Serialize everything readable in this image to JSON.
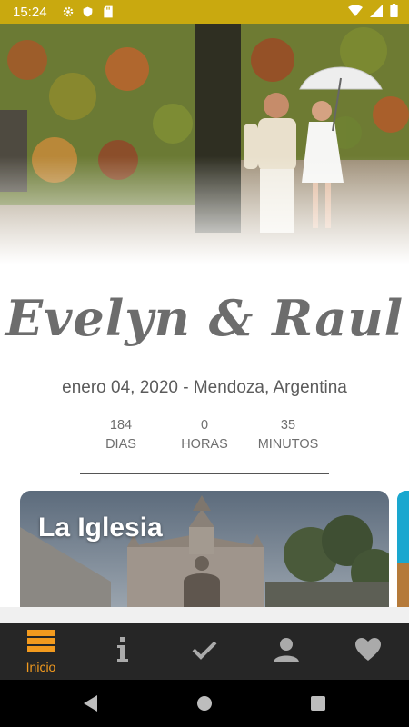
{
  "status_bar": {
    "time": "15:24",
    "left_icons": [
      "gear-icon",
      "shield-icon",
      "sd-card-icon"
    ],
    "right_icons": [
      "wifi-icon",
      "signal-icon",
      "battery-icon"
    ],
    "background": "#c9a90f"
  },
  "hero": {
    "description_icon": "couple-photo"
  },
  "event": {
    "title": "Evelyn & Raul",
    "date_location": "enero 04, 2020 - Mendoza, Argentina"
  },
  "countdown": [
    {
      "value": "184",
      "unit": "DIAS"
    },
    {
      "value": "0",
      "unit": "HORAS"
    },
    {
      "value": "35",
      "unit": "MINUTOS"
    }
  ],
  "cards": [
    {
      "title": "La Iglesia"
    }
  ],
  "bottom_nav": {
    "accent": "#f29a1e",
    "items": [
      {
        "icon": "home-list-icon",
        "label": "Inicio",
        "active": true
      },
      {
        "icon": "info-icon",
        "label": "",
        "active": false
      },
      {
        "icon": "check-icon",
        "label": "",
        "active": false
      },
      {
        "icon": "person-icon",
        "label": "",
        "active": false
      },
      {
        "icon": "heart-icon",
        "label": "",
        "active": false
      }
    ]
  },
  "system_nav": [
    "back-icon",
    "home-icon",
    "recents-icon"
  ]
}
